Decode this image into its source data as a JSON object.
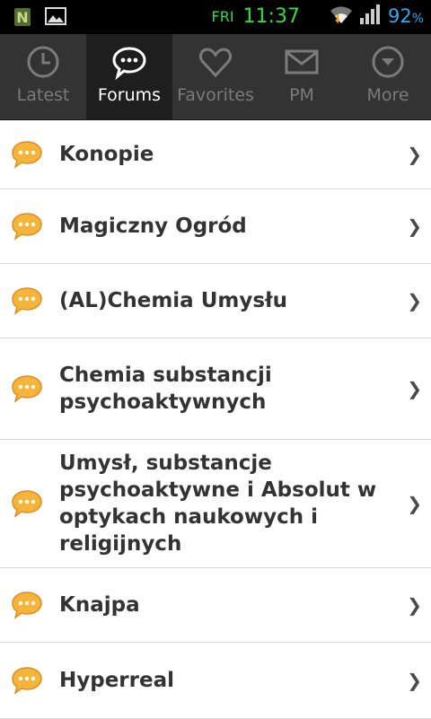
{
  "status_bar": {
    "day": "FRI",
    "time": "11:37",
    "battery": "92",
    "battery_unit": "%"
  },
  "tabs": [
    {
      "label": "Latest",
      "icon": "clock-icon"
    },
    {
      "label": "Forums",
      "icon": "chat-bubble-icon"
    },
    {
      "label": "Favorites",
      "icon": "heart-icon"
    },
    {
      "label": "PM",
      "icon": "envelope-icon"
    },
    {
      "label": "More",
      "icon": "chevron-circle-icon"
    }
  ],
  "forums": [
    {
      "title": "Konopie"
    },
    {
      "title": "Magiczny Ogród"
    },
    {
      "title": "(AL)Chemia Umysłu"
    },
    {
      "title": "Chemia substancji psychoaktywnych"
    },
    {
      "title": "Umysł, substancje psychoaktywne i Absolut w optykach naukowych i religijnych"
    },
    {
      "title": "Knajpa"
    },
    {
      "title": "Hyperreal"
    }
  ],
  "colors": {
    "accent_green": "#39d84a",
    "battery_blue": "#35a8e8",
    "bubble_orange": "#f5b43a"
  }
}
